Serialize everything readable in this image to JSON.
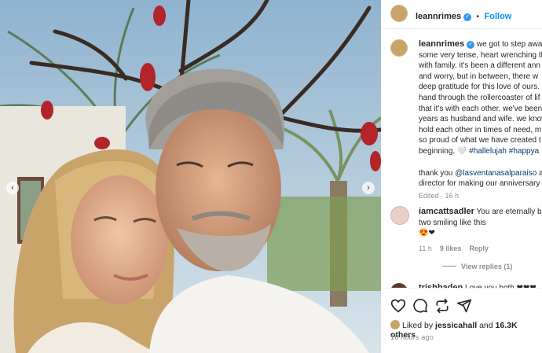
{
  "post": {
    "username": "leannrimes",
    "follow_label": "Follow"
  },
  "caption": {
    "username": "leannrimes",
    "lines": [
      "we got to step away f",
      "some very tense, heart wrenching th",
      "with family. it's been a different ann",
      "and worry, but in between, there w",
      "deep gratitude for this love of ours.",
      "hand through the rollercoaster of lif",
      "that it's with each other. we've been",
      "years as husband and wife. we know",
      "hold each other in times of need, m",
      "so proud of what we have created t",
      "beginning. 🤍 "
    ],
    "hashtags": "#hallelujah #happya",
    "thanks_pre": "thank you ",
    "thanks_mention": "@lasventanasalparaiso",
    "thanks_post": " a",
    "thanks_line2": "director for making our anniversary",
    "edited": "Edited · 16 h"
  },
  "comments": [
    {
      "username": "iamcattsadler",
      "text": "You are eternally b",
      "line2": "two smiling like this",
      "emoji": "😍❤",
      "age": "11 h",
      "likes": "9 likes",
      "reply": "Reply",
      "view_replies": "View replies (1)"
    },
    {
      "username": "trishbaden",
      "text": "Love you both ❤❤❤"
    }
  ],
  "likes": {
    "prefix": "Liked by ",
    "user": "jessicahall",
    "mid": " and ",
    "count": "16.3K others"
  },
  "timestamp": "16 hours ago",
  "colors": {
    "link": "#0095f6",
    "verified": "#3897f0",
    "hashtag": "#00376b",
    "muted": "#8e8e8e"
  },
  "icons": [
    "heart-icon",
    "comment-icon",
    "repost-icon",
    "share-icon",
    "verified-icon",
    "prev-arrow-icon",
    "next-arrow-icon"
  ]
}
